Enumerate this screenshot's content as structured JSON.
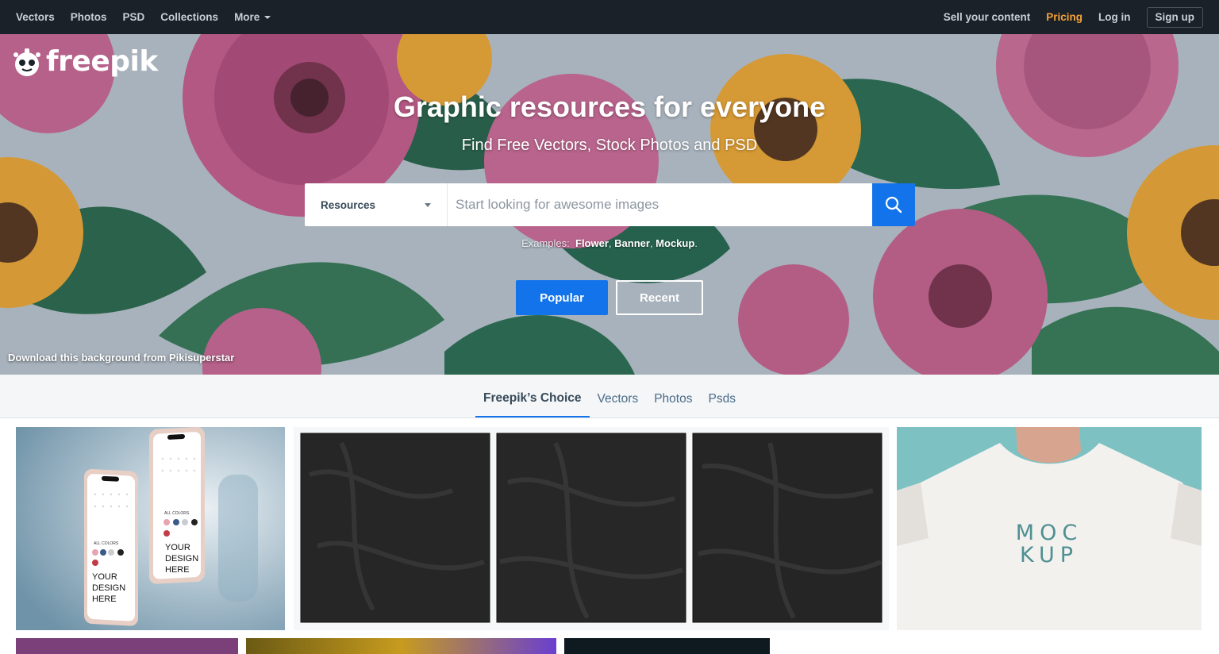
{
  "topnav": {
    "left": [
      {
        "label": "Vectors"
      },
      {
        "label": "Photos"
      },
      {
        "label": "PSD"
      },
      {
        "label": "Collections"
      },
      {
        "label": "More"
      }
    ],
    "sell": "Sell your content",
    "pricing": "Pricing",
    "login": "Log in",
    "signup": "Sign up"
  },
  "brand": {
    "logo_text": "freepik"
  },
  "hero": {
    "title": "Graphic resources for everyone",
    "subtitle": "Find Free Vectors, Stock Photos and PSD",
    "search": {
      "category": "Resources",
      "placeholder": "Start looking for awesome images"
    },
    "examples_label": "Examples:",
    "examples": [
      "Flower",
      "Banner",
      "Mockup"
    ],
    "btn_popular": "Popular",
    "btn_recent": "Recent",
    "credit": "Download this background from Pikisuperstar"
  },
  "tabs": [
    {
      "label": "Freepik’s Choice",
      "active": true
    },
    {
      "label": "Vectors"
    },
    {
      "label": "Photos"
    },
    {
      "label": "Psds"
    }
  ],
  "cards": {
    "phone_left": {
      "lines": [
        "YOUR",
        "DESIGN",
        "HERE"
      ],
      "caption": "ALL COLORS"
    },
    "phone_right": {
      "lines": [
        "YOUR",
        "DESIGN",
        "HERE"
      ],
      "caption": "ALL COLORS"
    },
    "tshirt": {
      "line1": "MOC",
      "line2": "KUP"
    }
  },
  "colors": {
    "nav_bg": "#1b2129",
    "accent_blue": "#1273eb",
    "pricing_orange": "#f2a33a"
  }
}
